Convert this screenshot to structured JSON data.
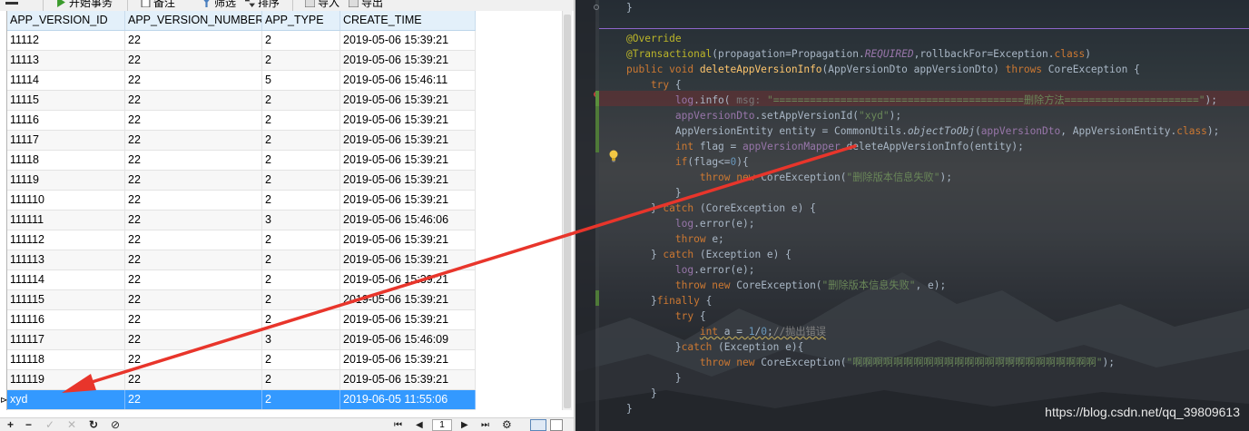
{
  "toolbar": {
    "items": [
      {
        "label": "开始事务",
        "icon": "play-icon"
      },
      {
        "label": "备注",
        "icon": "note-icon"
      },
      {
        "label": "筛选",
        "icon": "filter-icon"
      },
      {
        "label": "排序",
        "icon": "sort-icon"
      },
      {
        "label": "导入",
        "icon": "import-icon"
      },
      {
        "label": "导出",
        "icon": "export-icon"
      }
    ]
  },
  "grid": {
    "columns": [
      "APP_VERSION_ID",
      "APP_VERSION_NUMBER",
      "APP_TYPE",
      "CREATE_TIME"
    ],
    "rows": [
      [
        "11112",
        "22",
        "2",
        "2019-05-06 15:39:21"
      ],
      [
        "11113",
        "22",
        "2",
        "2019-05-06 15:39:21"
      ],
      [
        "11114",
        "22",
        "5",
        "2019-05-06 15:46:11"
      ],
      [
        "11115",
        "22",
        "2",
        "2019-05-06 15:39:21"
      ],
      [
        "11116",
        "22",
        "2",
        "2019-05-06 15:39:21"
      ],
      [
        "11117",
        "22",
        "2",
        "2019-05-06 15:39:21"
      ],
      [
        "11118",
        "22",
        "2",
        "2019-05-06 15:39:21"
      ],
      [
        "11119",
        "22",
        "2",
        "2019-05-06 15:39:21"
      ],
      [
        "111110",
        "22",
        "2",
        "2019-05-06 15:39:21"
      ],
      [
        "111111",
        "22",
        "3",
        "2019-05-06 15:46:06"
      ],
      [
        "111112",
        "22",
        "2",
        "2019-05-06 15:39:21"
      ],
      [
        "111113",
        "22",
        "2",
        "2019-05-06 15:39:21"
      ],
      [
        "111114",
        "22",
        "2",
        "2019-05-06 15:39:21"
      ],
      [
        "111115",
        "22",
        "2",
        "2019-05-06 15:39:21"
      ],
      [
        "111116",
        "22",
        "2",
        "2019-05-06 15:39:21"
      ],
      [
        "111117",
        "22",
        "3",
        "2019-05-06 15:46:09"
      ],
      [
        "111118",
        "22",
        "2",
        "2019-05-06 15:39:21"
      ],
      [
        "111119",
        "22",
        "2",
        "2019-05-06 15:39:21"
      ]
    ],
    "selected_row": [
      "xyd",
      "22",
      "2",
      "2019-06-05 11:55:06"
    ],
    "row_marker": "⊳"
  },
  "bottom_toolbar": {
    "add": "+",
    "delete": "−",
    "apply": "✓",
    "discard": "✕",
    "refresh": "↻",
    "stop": "⊘",
    "first": "⏮",
    "prev": "◀",
    "page": "1",
    "next": "▶",
    "last": "⏭",
    "settings": "⚙"
  },
  "code": {
    "lines": [
      [
        {
          "t": "}",
          "c": ""
        }
      ],
      [],
      [
        {
          "t": "@Override",
          "c": "ann"
        }
      ],
      [
        {
          "t": "@Transactional",
          "c": "ann"
        },
        {
          "t": "(propagation=Propagation.",
          "c": ""
        },
        {
          "t": "REQUIRED",
          "c": "fld it"
        },
        {
          "t": ",rollbackFor=Exception.",
          "c": ""
        },
        {
          "t": "class",
          "c": "kw"
        },
        {
          "t": ")",
          "c": ""
        }
      ],
      [
        {
          "t": "public void ",
          "c": "kw"
        },
        {
          "t": "deleteAppVersionInfo",
          "c": "meth"
        },
        {
          "t": "(AppVersionDto appVersionDto) ",
          "c": ""
        },
        {
          "t": "throws ",
          "c": "kw"
        },
        {
          "t": "CoreException {",
          "c": ""
        }
      ],
      [
        {
          "t": "    try ",
          "c": "kw"
        },
        {
          "t": "{",
          "c": ""
        }
      ],
      [
        {
          "t": "        ",
          "c": ""
        },
        {
          "t": "log",
          "c": "fld"
        },
        {
          "t": ".info( ",
          "c": ""
        },
        {
          "t": "msg: ",
          "c": "hint"
        },
        {
          "t": "\"=========================================删除方法======================\"",
          "c": "str"
        },
        {
          "t": ");",
          "c": ""
        }
      ],
      [
        {
          "t": "        ",
          "c": ""
        },
        {
          "t": "appVersionDto",
          "c": "fld"
        },
        {
          "t": ".setAppVersionId(",
          "c": ""
        },
        {
          "t": "\"xyd\"",
          "c": "str"
        },
        {
          "t": ");",
          "c": ""
        }
      ],
      [
        {
          "t": "        AppVersionEntity entity = CommonUtils.",
          "c": ""
        },
        {
          "t": "objectToObj",
          "c": "it"
        },
        {
          "t": "(",
          "c": ""
        },
        {
          "t": "appVersionDto",
          "c": "fld"
        },
        {
          "t": ", AppVersionEntity.",
          "c": ""
        },
        {
          "t": "class",
          "c": "kw"
        },
        {
          "t": ");",
          "c": ""
        }
      ],
      [
        {
          "t": "        ",
          "c": ""
        },
        {
          "t": "int ",
          "c": "kw"
        },
        {
          "t": "flag = ",
          "c": ""
        },
        {
          "t": "appVersionMapper",
          "c": "fld"
        },
        {
          "t": ".deleteAppVersionInfo(entity);",
          "c": ""
        }
      ],
      [
        {
          "t": "        ",
          "c": ""
        },
        {
          "t": "if",
          "c": "kw"
        },
        {
          "t": "(flag<=",
          "c": ""
        },
        {
          "t": "0",
          "c": "num"
        },
        {
          "t": "){",
          "c": ""
        }
      ],
      [
        {
          "t": "            ",
          "c": ""
        },
        {
          "t": "throw new ",
          "c": "kw"
        },
        {
          "t": "CoreException(",
          "c": ""
        },
        {
          "t": "\"删除版本信息失败\"",
          "c": "str"
        },
        {
          "t": ");",
          "c": ""
        }
      ],
      [
        {
          "t": "        }",
          "c": ""
        }
      ],
      [
        {
          "t": "    } ",
          "c": ""
        },
        {
          "t": "catch ",
          "c": "kw"
        },
        {
          "t": "(CoreException e) {",
          "c": ""
        }
      ],
      [
        {
          "t": "        ",
          "c": ""
        },
        {
          "t": "log",
          "c": "fld"
        },
        {
          "t": ".error(e);",
          "c": ""
        }
      ],
      [
        {
          "t": "        ",
          "c": ""
        },
        {
          "t": "throw ",
          "c": "kw"
        },
        {
          "t": "e;",
          "c": ""
        }
      ],
      [
        {
          "t": "    } ",
          "c": ""
        },
        {
          "t": "catch ",
          "c": "kw"
        },
        {
          "t": "(Exception e) {",
          "c": ""
        }
      ],
      [
        {
          "t": "        ",
          "c": ""
        },
        {
          "t": "log",
          "c": "fld"
        },
        {
          "t": ".error(e);",
          "c": ""
        }
      ],
      [
        {
          "t": "        ",
          "c": ""
        },
        {
          "t": "throw new ",
          "c": "kw"
        },
        {
          "t": "CoreException(",
          "c": ""
        },
        {
          "t": "\"删除版本信息失败\"",
          "c": "str"
        },
        {
          "t": ", e);",
          "c": ""
        }
      ],
      [
        {
          "t": "    }",
          "c": ""
        },
        {
          "t": "finally ",
          "c": "kw"
        },
        {
          "t": "{",
          "c": ""
        }
      ],
      [
        {
          "t": "        ",
          "c": ""
        },
        {
          "t": "try ",
          "c": "kw"
        },
        {
          "t": "{",
          "c": ""
        }
      ],
      [
        {
          "t": "            ",
          "c": ""
        },
        {
          "t": "int ",
          "c": "kw squig"
        },
        {
          "t": "a = ",
          "c": "squig"
        },
        {
          "t": "1",
          "c": "num squig"
        },
        {
          "t": "/",
          "c": "squig"
        },
        {
          "t": "0",
          "c": "num squig"
        },
        {
          "t": ";",
          "c": "squig"
        },
        {
          "t": "//抛出错误",
          "c": "cmt squig"
        }
      ],
      [
        {
          "t": "        }",
          "c": ""
        },
        {
          "t": "catch ",
          "c": "kw"
        },
        {
          "t": "(Exception e){",
          "c": ""
        }
      ],
      [
        {
          "t": "            ",
          "c": ""
        },
        {
          "t": "throw new ",
          "c": "kw"
        },
        {
          "t": "CoreException(",
          "c": ""
        },
        {
          "t": "\"啊啊啊啊啊啊啊啊啊啊啊啊啊啊啊啊啊啊啊啊啊啊啊啊\"",
          "c": "str"
        },
        {
          "t": ");",
          "c": ""
        }
      ],
      [
        {
          "t": "        }",
          "c": ""
        }
      ],
      [
        {
          "t": "    }",
          "c": ""
        }
      ],
      [
        {
          "t": "}",
          "c": ""
        }
      ]
    ]
  },
  "watermark": "https://blog.csdn.net/qq_39809613",
  "colors": {
    "selection": "#3399ff",
    "header_bg": "#e3f0fa",
    "annotation_arrow": "#e8352b",
    "editor_keyword": "#cc7832",
    "editor_string": "#6a8759"
  }
}
